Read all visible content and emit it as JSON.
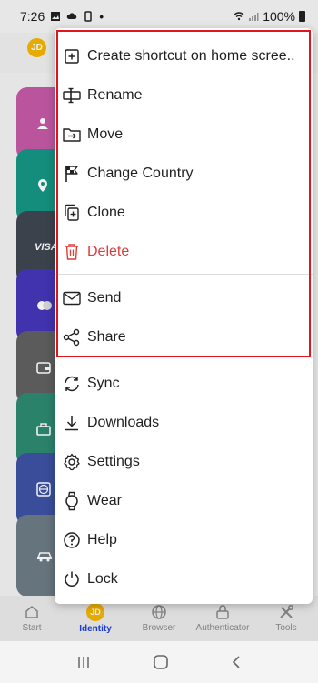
{
  "status_bar": {
    "time": "7:26",
    "battery": "100%"
  },
  "header": {
    "avatar_initials": "JD"
  },
  "cards": [
    {
      "icon": "person-icon"
    },
    {
      "icon": "location-pin-icon"
    },
    {
      "icon": "visa-card-icon",
      "label": "VISA"
    },
    {
      "icon": "mastercard-icon"
    },
    {
      "icon": "wallet-icon"
    },
    {
      "icon": "briefcase-icon"
    },
    {
      "icon": "globe-icon"
    },
    {
      "icon": "car-icon"
    }
  ],
  "menu": {
    "items": [
      {
        "label": "Create shortcut on home scree..",
        "icon": "add-shortcut-icon"
      },
      {
        "label": "Rename",
        "icon": "rename-icon"
      },
      {
        "label": "Move",
        "icon": "move-folder-icon"
      },
      {
        "label": "Change Country",
        "icon": "flag-icon"
      },
      {
        "label": "Clone",
        "icon": "clone-icon"
      },
      {
        "label": "Delete",
        "icon": "trash-icon"
      },
      {
        "label": "Send",
        "icon": "envelope-icon"
      },
      {
        "label": "Share",
        "icon": "share-icon"
      },
      {
        "label": "Sync",
        "icon": "sync-icon"
      },
      {
        "label": "Downloads",
        "icon": "download-icon"
      },
      {
        "label": "Settings",
        "icon": "gear-icon"
      },
      {
        "label": "Wear",
        "icon": "watch-icon"
      },
      {
        "label": "Help",
        "icon": "help-icon"
      },
      {
        "label": "Lock",
        "icon": "power-icon"
      }
    ]
  },
  "bottom_nav": [
    {
      "label": "Start",
      "icon": "home-icon"
    },
    {
      "label": "Identity",
      "icon": "avatar",
      "avatar_initials": "JD",
      "active": true
    },
    {
      "label": "Browser",
      "icon": "globe-icon"
    },
    {
      "label": "Authenticator",
      "icon": "lock-icon"
    },
    {
      "label": "Tools",
      "icon": "tools-icon"
    }
  ],
  "colors": {
    "accent": "#1d3fd6",
    "danger": "#e03b3b",
    "highlight": "#e0161b"
  }
}
